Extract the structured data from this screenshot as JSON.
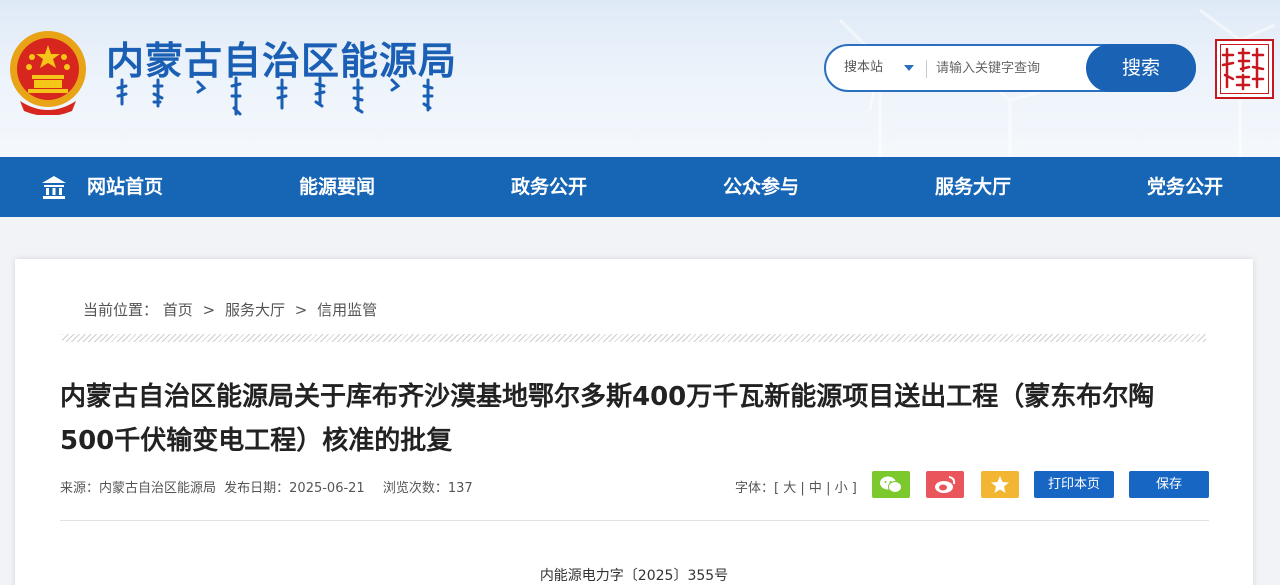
{
  "header": {
    "site_title": "内蒙古自治区能源局",
    "emblem_icon": "national-emblem-icon",
    "seal_icon": "inner-mongolia-seal-icon",
    "colors": {
      "brand_blue": "#1a5fb4",
      "nav_blue": "#1766b5",
      "seal_red": "#c8171e"
    }
  },
  "search": {
    "scope": "搜本站",
    "placeholder": "请输入关键字查询",
    "button_label": "搜索"
  },
  "nav": {
    "items": [
      {
        "label": "网站首页",
        "icon": "home-icon"
      },
      {
        "label": "能源要闻"
      },
      {
        "label": "政务公开"
      },
      {
        "label": "公众参与"
      },
      {
        "label": "服务大厅"
      },
      {
        "label": "党务公开"
      }
    ]
  },
  "breadcrumb": {
    "prefix": "当前位置：",
    "items": [
      "首页",
      "服务大厅",
      "信用监管"
    ],
    "separator": ">"
  },
  "article": {
    "title": "内蒙古自治区能源局关于库布齐沙漠基地鄂尔多斯400万千瓦新能源项目送出工程（蒙东布尔陶500千伏输变电工程）核准的批复",
    "source": "来源：内蒙古自治区能源局",
    "publish_date": "发布日期：2025-06-21",
    "views": "浏览次数：137",
    "doc_number": "内能源电力字〔2025〕355号"
  },
  "toolbar": {
    "font_label": "字体：[",
    "font_large": "大",
    "font_medium": "中",
    "font_small": "小",
    "font_sep": "|",
    "font_close": "]",
    "share_wechat_color": "#7bc92d",
    "share_weibo_color": "#e9555a",
    "share_favorite_color": "#f2b632",
    "print_label": "打印本页",
    "save_label": "保存"
  }
}
